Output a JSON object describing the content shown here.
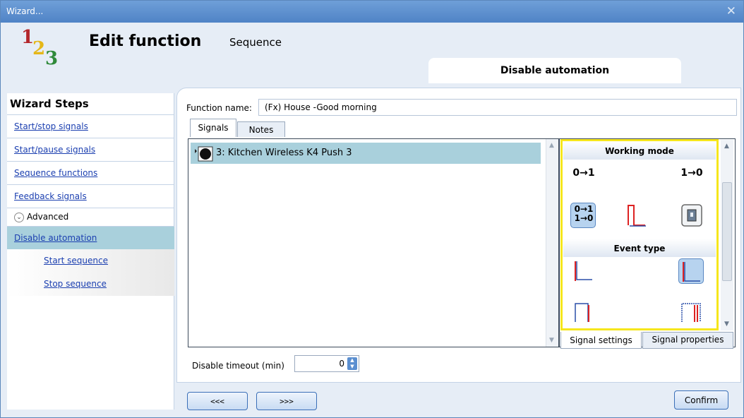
{
  "window": {
    "title": "Wizard...",
    "close_glyph": "✕"
  },
  "logo": {
    "d1": "1",
    "d2": "2",
    "d3": "3"
  },
  "header": {
    "title": "Edit function",
    "subtitle": "Sequence",
    "section": "Disable automation"
  },
  "sidebar": {
    "title": "Wizard Steps",
    "items": [
      {
        "label": "Start/stop signals"
      },
      {
        "label": "Start/pause signals"
      },
      {
        "label": "Sequence functions"
      },
      {
        "label": "Feedback signals"
      }
    ],
    "advanced_label": "Advanced",
    "selected_item": {
      "label": "Disable automation"
    },
    "sub_items": [
      {
        "label": "Start sequence"
      },
      {
        "label": "Stop sequence"
      }
    ]
  },
  "function_name": {
    "label": "Function name:",
    "value": "(Fx) House -Good morning"
  },
  "tabs": [
    {
      "label": "Signals"
    },
    {
      "label": "Notes"
    }
  ],
  "signals": [
    {
      "label": "3: Kitchen Wireless K4 Push 3"
    }
  ],
  "signal_settings": {
    "working_mode_title": "Working mode",
    "working_mode_buttons": [
      {
        "label": "0→1",
        "selected": false
      },
      {
        "label": "1→0",
        "selected": false
      },
      {
        "label": "0→1 1→0",
        "selected": true
      }
    ],
    "event_type_title": "Event type"
  },
  "bottom_tabs": [
    {
      "label": "Signal settings"
    },
    {
      "label": "Signal properties"
    }
  ],
  "disable_timeout": {
    "label": "Disable timeout (min)",
    "value": "0"
  },
  "nav": {
    "prev_label": "<<<",
    "next_label": ">>>",
    "confirm_label": "Confirm"
  }
}
